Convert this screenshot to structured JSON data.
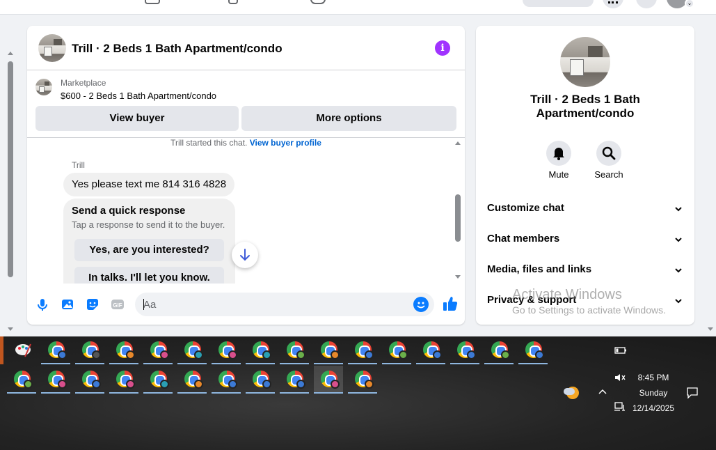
{
  "chat": {
    "title": "Trill · 2 Beds 1 Bath Apartment/condo",
    "marketplace_label": "Marketplace",
    "listing": "$600 - 2 Beds 1 Bath Apartment/condo",
    "view_buyer": "View buyer",
    "more_options": "More options",
    "started_text": "Trill started this chat.",
    "view_buyer_profile": "View buyer profile",
    "sender": "Trill",
    "message": "Yes please text me 814 316 4828",
    "quick_title": "Send a quick response",
    "quick_subtitle": "Tap a response to send it to the buyer.",
    "quick_responses": [
      "Yes, are you interested?",
      "In talks. I'll let you know."
    ],
    "input_placeholder": "Aa",
    "accent": "#0a7cff",
    "info_color": "#a033ff"
  },
  "info_panel": {
    "title": "Trill · 2 Beds 1 Bath Apartment/condo",
    "actions": [
      {
        "label": "Mute",
        "icon": "bell-icon"
      },
      {
        "label": "Search",
        "icon": "search-icon"
      }
    ],
    "sections": [
      "Customize chat",
      "Chat members",
      "Media, files and links",
      "Privacy & support"
    ]
  },
  "watermark": {
    "title": "Activate Windows",
    "subtitle": "Go to Settings to activate Windows."
  },
  "taskbar": {
    "time": "8:45 PM",
    "day": "Sunday",
    "date": "12/14/2025",
    "profile_colors_row1": [
      "#3c7ad6",
      "#555555",
      "#e8882a",
      "#d94f8c",
      "#2a9fb3",
      "#d94f8c",
      "#2a9fb3",
      "#6bb04a",
      "#e8882a",
      "#3c7ad6",
      "#6bb04a",
      "#3c7ad6",
      "#3c7ad6",
      "#6bb04a",
      "#3c7ad6"
    ],
    "profile_colors_row2": [
      "#6bb04a",
      "#d94f8c",
      "#3c7ad6",
      "#d94f8c",
      "#2a9fb3",
      "#e8882a",
      "#3c7ad6",
      "#3c7ad6",
      "#3c7ad6",
      "#d94f8c",
      "#e8882a"
    ]
  }
}
